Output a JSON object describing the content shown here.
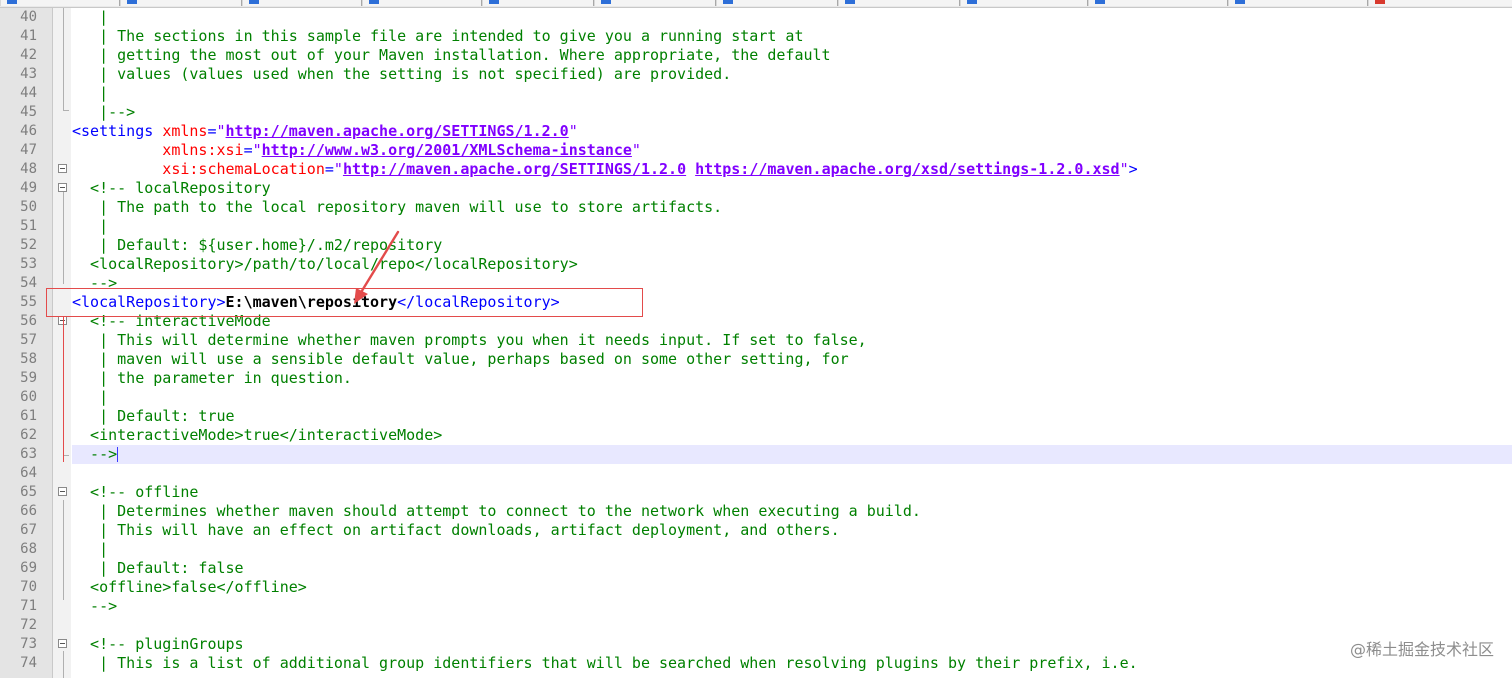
{
  "editor": {
    "lines": [
      {
        "n": "40",
        "segs": [
          {
            "c": "cm",
            "t": "   |"
          }
        ]
      },
      {
        "n": "41",
        "segs": [
          {
            "c": "cm",
            "t": "   | The sections in this sample file are intended to give you a running start at"
          }
        ]
      },
      {
        "n": "42",
        "segs": [
          {
            "c": "cm",
            "t": "   | getting the most out of your Maven installation. Where appropriate, the default"
          }
        ]
      },
      {
        "n": "43",
        "segs": [
          {
            "c": "cm",
            "t": "   | values (values used when the setting is not specified) are provided."
          }
        ]
      },
      {
        "n": "44",
        "segs": [
          {
            "c": "cm",
            "t": "   |"
          }
        ]
      },
      {
        "n": "45",
        "segs": [
          {
            "c": "cm",
            "t": "   |-->"
          }
        ]
      },
      {
        "n": "46",
        "segs": [
          {
            "c": "tag",
            "t": "<settings "
          },
          {
            "c": "attr",
            "t": "xmlns"
          },
          {
            "c": "tag",
            "t": "="
          },
          {
            "c": "quote",
            "t": "\""
          },
          {
            "c": "url",
            "t": "http://maven.apache.org/SETTINGS/1.2.0"
          },
          {
            "c": "quote",
            "t": "\""
          }
        ]
      },
      {
        "n": "47",
        "segs": [
          {
            "c": "attr",
            "t": "          xmlns:xsi"
          },
          {
            "c": "tag",
            "t": "="
          },
          {
            "c": "quote",
            "t": "\""
          },
          {
            "c": "url",
            "t": "http://www.w3.org/2001/XMLSchema-instance"
          },
          {
            "c": "quote",
            "t": "\""
          }
        ]
      },
      {
        "n": "48",
        "segs": [
          {
            "c": "attr",
            "t": "          xsi:schemaLocation"
          },
          {
            "c": "tag",
            "t": "="
          },
          {
            "c": "quote",
            "t": "\""
          },
          {
            "c": "url",
            "t": "http://maven.apache.org/SETTINGS/1.2.0"
          },
          {
            "c": "quote",
            "t": " "
          },
          {
            "c": "url",
            "t": "https://maven.apache.org/xsd/settings-1.2.0.xsd"
          },
          {
            "c": "quote",
            "t": "\""
          },
          {
            "c": "tag",
            "t": ">"
          }
        ]
      },
      {
        "n": "49",
        "segs": [
          {
            "c": "cm",
            "t": "  <!-- localRepository"
          }
        ]
      },
      {
        "n": "50",
        "segs": [
          {
            "c": "cm",
            "t": "   | The path to the local repository maven will use to store artifacts."
          }
        ]
      },
      {
        "n": "51",
        "segs": [
          {
            "c": "cm",
            "t": "   |"
          }
        ]
      },
      {
        "n": "52",
        "segs": [
          {
            "c": "cm",
            "t": "   | Default: ${user.home}/.m2/repository"
          }
        ]
      },
      {
        "n": "53",
        "segs": [
          {
            "c": "cm",
            "t": "  <localRepository>/path/to/local/repo</localRepository>"
          }
        ]
      },
      {
        "n": "54",
        "segs": [
          {
            "c": "cm",
            "t": "  -->"
          }
        ]
      },
      {
        "n": "55",
        "segs": [
          {
            "c": "tag",
            "t": "<localRepository>"
          },
          {
            "c": "txt",
            "t": "E:\\maven\\repository"
          },
          {
            "c": "tag",
            "t": "</localRepository>"
          }
        ]
      },
      {
        "n": "56",
        "segs": [
          {
            "c": "cm",
            "t": "  <!-- interactiveMode"
          }
        ]
      },
      {
        "n": "57",
        "segs": [
          {
            "c": "cm",
            "t": "   | This will determine whether maven prompts you when it needs input. If set to false,"
          }
        ]
      },
      {
        "n": "58",
        "segs": [
          {
            "c": "cm",
            "t": "   | maven will use a sensible default value, perhaps based on some other setting, for"
          }
        ]
      },
      {
        "n": "59",
        "segs": [
          {
            "c": "cm",
            "t": "   | the parameter in question."
          }
        ]
      },
      {
        "n": "60",
        "segs": [
          {
            "c": "cm",
            "t": "   |"
          }
        ]
      },
      {
        "n": "61",
        "segs": [
          {
            "c": "cm",
            "t": "   | Default: true"
          }
        ]
      },
      {
        "n": "62",
        "segs": [
          {
            "c": "cm",
            "t": "  <interactiveMode>true</interactiveMode>"
          }
        ]
      },
      {
        "n": "63",
        "segs": [
          {
            "c": "cm",
            "t": "  -->"
          }
        ],
        "current": true
      },
      {
        "n": "64",
        "segs": []
      },
      {
        "n": "65",
        "segs": [
          {
            "c": "cm",
            "t": "  <!-- offline"
          }
        ]
      },
      {
        "n": "66",
        "segs": [
          {
            "c": "cm",
            "t": "   | Determines whether maven should attempt to connect to the network when executing a build."
          }
        ]
      },
      {
        "n": "67",
        "segs": [
          {
            "c": "cm",
            "t": "   | This will have an effect on artifact downloads, artifact deployment, and others."
          }
        ]
      },
      {
        "n": "68",
        "segs": [
          {
            "c": "cm",
            "t": "   |"
          }
        ]
      },
      {
        "n": "69",
        "segs": [
          {
            "c": "cm",
            "t": "   | Default: false"
          }
        ]
      },
      {
        "n": "70",
        "segs": [
          {
            "c": "cm",
            "t": "  <offline>false</offline>"
          }
        ]
      },
      {
        "n": "71",
        "segs": [
          {
            "c": "cm",
            "t": "  -->"
          }
        ]
      },
      {
        "n": "72",
        "segs": []
      },
      {
        "n": "73",
        "segs": [
          {
            "c": "cm",
            "t": "  <!-- pluginGroups"
          }
        ]
      },
      {
        "n": "74",
        "segs": [
          {
            "c": "cm",
            "t": "   | This is a list of additional group identifiers that will be searched when resolving plugins by their prefix, i.e."
          }
        ]
      }
    ],
    "fold_boxes": [
      "48",
      "49",
      "56",
      "65",
      "73"
    ]
  },
  "colors": {
    "tag": "#0000ff",
    "attr": "#ff0000",
    "comment": "#008000",
    "url": "#8000ff",
    "highlight": "#e34b4b",
    "current_line": "#e8e8ff"
  },
  "watermark": "@稀土掘金技术社区"
}
